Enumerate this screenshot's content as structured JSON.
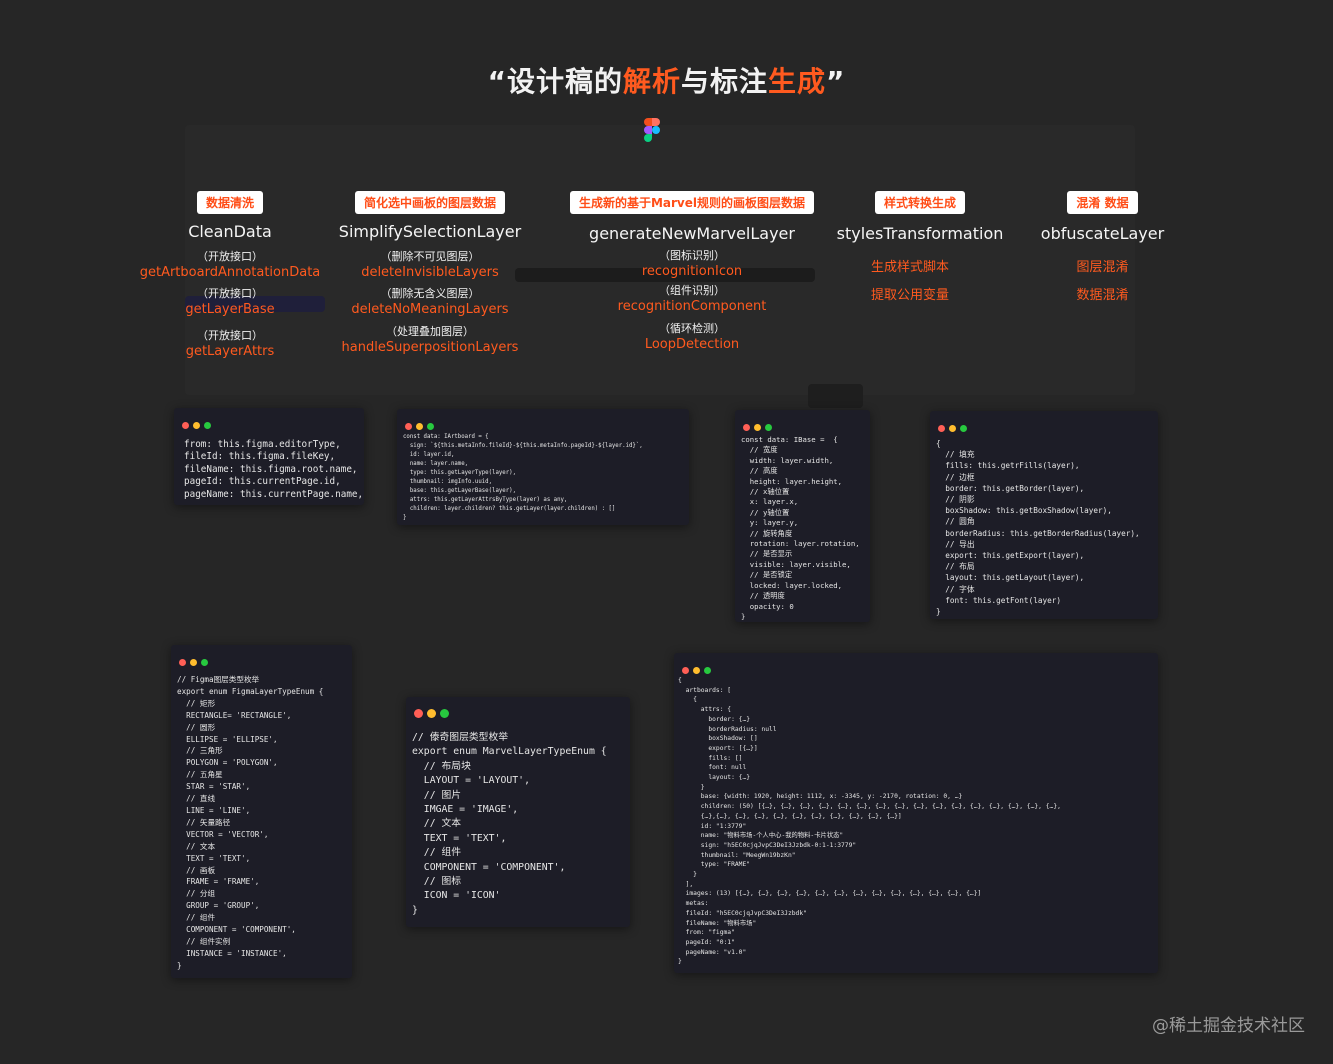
{
  "title": {
    "q_open": "“",
    "part1": "设计稿的",
    "hl1": "解析",
    "part2": "与标注",
    "hl2": "生成",
    "q_close": "”"
  },
  "colors": {
    "accent": "#ff5a1f",
    "background": "#262626",
    "code_bg": "#1d1d27"
  },
  "columns": [
    {
      "badge": "数据清洗",
      "name": "CleanData",
      "items": [
        {
          "note": "（开放接口）",
          "link": "getArtboardAnnotationData"
        },
        {
          "note": "（开放接口）",
          "link": "getLayerBase"
        },
        {
          "note": "（开放接口）",
          "link": "getLayerAttrs"
        }
      ]
    },
    {
      "badge": "简化选中画板的图层数据",
      "name": "SimplifySelectionLayer",
      "items": [
        {
          "note": "（删除不可见图层）",
          "link": "deleteInvisibleLayers"
        },
        {
          "note": "（删除无含义图层）",
          "link": "deleteNoMeaningLayers"
        },
        {
          "note": "（处理叠加图层）",
          "link": "handleSuperpositionLayers"
        }
      ]
    },
    {
      "badge": "生成新的基于Marvel规则的画板图层数据",
      "name": "generateNewMarvelLayer",
      "items": [
        {
          "note": "（图标识别）",
          "link": "recognitionIcon"
        },
        {
          "note": "（组件识别）",
          "link": "recognitionComponent"
        },
        {
          "note": "（循环检测）",
          "link": "LoopDetection"
        }
      ]
    },
    {
      "badge": "样式转换生成",
      "name": "stylesTransformation",
      "items": [
        {
          "note": "",
          "link": "生成样式脚本"
        },
        {
          "note": "",
          "link": "提取公用变量"
        }
      ]
    },
    {
      "badge": "混淆 数据",
      "name": "obfuscateLayer",
      "items": [
        {
          "note": "",
          "link": "图层混淆"
        },
        {
          "note": "",
          "link": "数据混淆"
        }
      ]
    }
  ],
  "code": {
    "clean": "from: this.figma.editorType,\nfileId: this.figma.fileKey,\nfileName: this.figma.root.name,\npageId: this.currentPage.id,\npageName: this.currentPage.name,",
    "simplify": "const data: IArtboard = {\n  sign: `${this.metaInfo.fileId}-${this.metaInfo.pageId}-${layer.id}`,\n  id: layer.id,\n  name: layer.name,\n  type: this.getLayerType(layer),\n  thumbnail: imgInfo.uuid,\n  base: this.getLayerBase(layer),\n  attrs: this.getLayerAttrsByType(layer) as any,\n  children: layer.children? this.getLayer(layer.children) : []\n}",
    "ibase": "const data: IBase =  {\n  // 宽度\n  width: layer.width,\n  // 高度\n  height: layer.height,\n  // x轴位置\n  x: layer.x,\n  // y轴位置\n  y: layer.y,\n  // 旋转角度\n  rotation: layer.rotation,\n  // 是否显示\n  visible: layer.visible,\n  // 是否锁定\n  locked: layer.locked,\n  // 透明度\n  opacity: 0\n}",
    "styles": "{\n  // 填充\n  fills: this.getrFills(layer),\n  // 边框\n  border: this.getBorder(layer),\n  // 阴影\n  boxShadow: this.getBoxShadow(layer),\n  // 圆角\n  borderRadius: this.getBorderRadius(layer),\n  // 导出\n  export: this.getExport(layer),\n  // 布局\n  layout: this.getLayout(layer),\n  // 字体\n  font: this.getFont(layer)\n}",
    "figma_enum": "// Figma图层类型枚举\nexport enum FigmaLayerTypeEnum {\n  // 矩形\n  RECTANGLE= 'RECTANGLE',\n  // 圆形\n  ELLIPSE = 'ELLIPSE',\n  // 三角形\n  POLYGON = 'POLYGON',\n  // 五角星\n  STAR = 'STAR',\n  // 直线\n  LINE = 'LINE',\n  // 矢量路径\n  VECTOR = 'VECTOR',\n  // 文本\n  TEXT = 'TEXT',\n  // 画板\n  FRAME = 'FRAME',\n  // 分组\n  GROUP = 'GROUP',\n  // 组件\n  COMPONENT = 'COMPONENT',\n  // 组件实例\n  INSTANCE = 'INSTANCE',\n}",
    "marvel_enum": "// 傣奇图层类型枚举\nexport enum MarvelLayerTypeEnum {\n  // 布局块\n  LAYOUT = 'LAYOUT',\n  // 图片\n  IMGAE = 'IMAGE',\n  // 文本\n  TEXT = 'TEXT',\n  // 组件\n  COMPONENT = 'COMPONENT',\n  // 图标\n  ICON = 'ICON'\n}",
    "output": "{\n  artboards: [\n    {\n      attrs: {\n        border: {…}\n        borderRadius: null\n        boxShadow: []\n        export: [{…}]\n        fills: []\n        font: null\n        layout: {…}\n      }\n      base: {width: 1920, height: 1112, x: -3345, y: -2170, rotation: 0, …}\n      children: (50) [{…}, {…}, {…}, {…}, {…}, {…}, {…}, {…}, {…}, {…}, {…}, {…}, {…}, {…}, {…}, {…},\n      {…},{…}, {…}, {…}, {…}, {…}, {…}, {…}, {…}, {…}, {…}]\n      id: \"1:3779\"\n      name: \"物料市场-个人中心-我的物料-卡片状态\"\n      sign: \"h5EC0cjqJvpC3DeI3Jzbdk-0:1-1:3779\"\n      thumbnail: \"MeegWn19bzKn\"\n      type: \"FRAME\"\n    }\n  ],\n  images: (13) [{…}, {…}, {…}, {…}, {…}, {…}, {…}, {…}, {…}, {…}, {…}, {…}, {…}]\n  metas:\n  fileId: \"h5EC0cjqJvpC3DeI3Jzbdk\"\n  fileName: \"物料市场\"\n  from: \"figma\"\n  pageId: \"0:1\"\n  pageName: \"v1.0\"\n}"
  },
  "watermark": "@稀土掘金技术社区"
}
